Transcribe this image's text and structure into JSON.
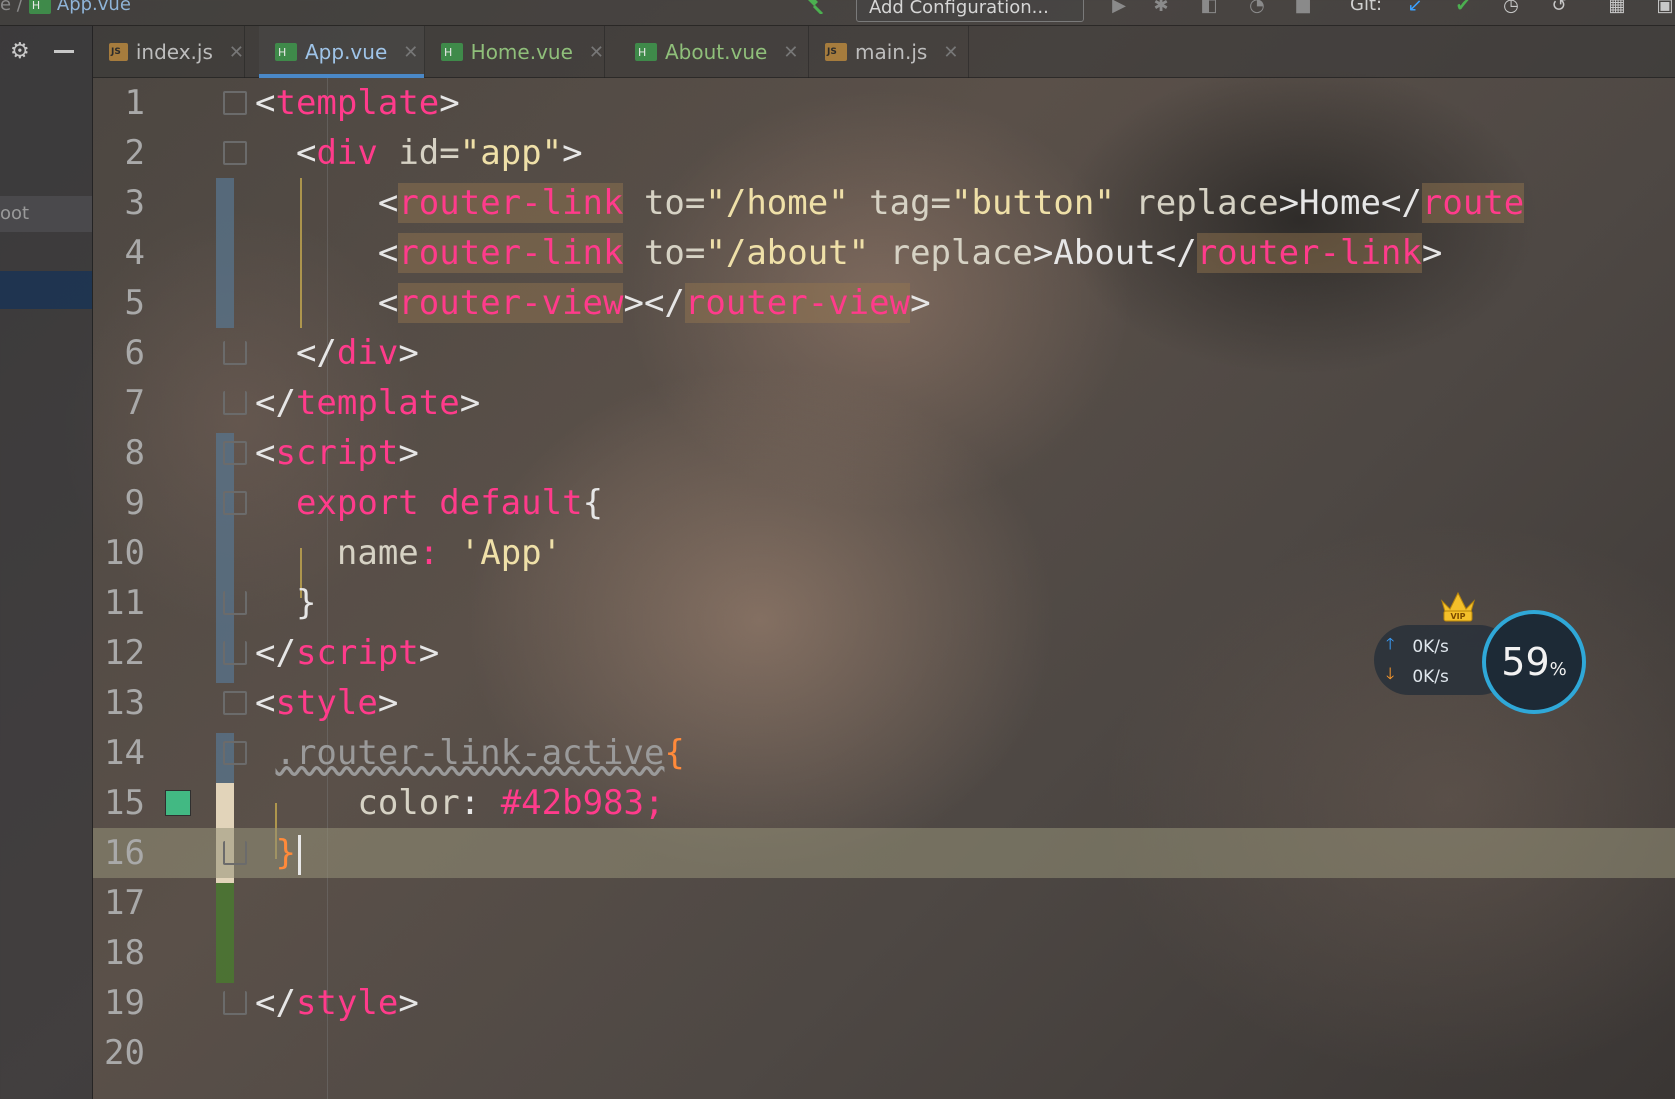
{
  "breadcrumb": {
    "file": "App.vue"
  },
  "toolbar": {
    "add_config_label": "Add Configuration...",
    "git_label": "Git:"
  },
  "sidebar": {
    "root_label": "oot"
  },
  "tabs": [
    {
      "name": "index.js",
      "kind": "js"
    },
    {
      "name": "App.vue",
      "kind": "vue",
      "active": true
    },
    {
      "name": "Home.vue",
      "kind": "vue"
    },
    {
      "name": "About.vue",
      "kind": "vue"
    },
    {
      "name": "main.js",
      "kind": "js"
    }
  ],
  "code": {
    "l1": {
      "n": "1"
    },
    "l2": {
      "n": "2"
    },
    "l3": {
      "n": "3"
    },
    "l4": {
      "n": "4"
    },
    "l5": {
      "n": "5"
    },
    "l6": {
      "n": "6"
    },
    "l7": {
      "n": "7"
    },
    "l8": {
      "n": "8"
    },
    "l9": {
      "n": "9"
    },
    "l10": {
      "n": "10"
    },
    "l11": {
      "n": "11"
    },
    "l12": {
      "n": "12"
    },
    "l13": {
      "n": "13"
    },
    "l14": {
      "n": "14"
    },
    "l15": {
      "n": "15"
    },
    "l16": {
      "n": "16"
    },
    "l17": {
      "n": "17"
    },
    "l18": {
      "n": "18"
    },
    "l19": {
      "n": "19"
    },
    "l20": {
      "n": "20"
    },
    "template": "template",
    "div": "div",
    "id_attr": " id=",
    "app_val": "\"app\"",
    "router_link": "router-link",
    "router_view": "router-view",
    "to_attr": " to=",
    "home_val": "\"/home\"",
    "about_val": "\"/about\"",
    "tag_attr": " tag=",
    "button_val": "\"button\"",
    "replace_attr": " replace",
    "home_text": "Home",
    "about_text": "About",
    "route_trunc": "route",
    "script": "script",
    "export_kw": "export",
    "default_kw": "default",
    "name_prop": "name",
    "colon": ":",
    "app_name": "'App'",
    "style": "style",
    "selector": ".router-link-active",
    "color_prop": "color",
    "color_value": "#42b983;",
    "swatch_color": "#42b983"
  },
  "net": {
    "up": "0K/s",
    "down": "0K/s",
    "percent": "59",
    "percent_unit": "%",
    "vip_label": "VIP"
  }
}
